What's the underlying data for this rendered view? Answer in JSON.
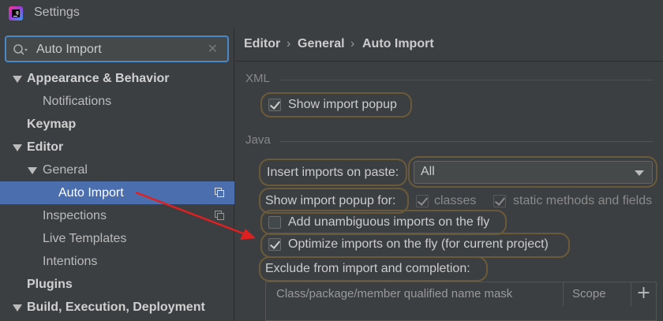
{
  "window": {
    "title": "Settings"
  },
  "search": {
    "value": "Auto Import",
    "clear_icon": "✕"
  },
  "tree": {
    "items": [
      {
        "label": "Appearance & Behavior"
      },
      {
        "label": "Notifications"
      },
      {
        "label": "Keymap"
      },
      {
        "label": "Editor"
      },
      {
        "label": "General"
      },
      {
        "label": "Auto Import"
      },
      {
        "label": "Inspections"
      },
      {
        "label": "Live Templates"
      },
      {
        "label": "Intentions"
      },
      {
        "label": "Plugins"
      },
      {
        "label": "Build, Execution, Deployment"
      }
    ]
  },
  "breadcrumb": {
    "items": [
      "Editor",
      "General",
      "Auto Import"
    ],
    "separator": "›"
  },
  "xml": {
    "section_title": "XML",
    "show_import_popup": {
      "label": "Show import popup",
      "checked": true
    }
  },
  "java": {
    "section_title": "Java",
    "insert_imports_on_paste": {
      "label": "Insert imports on paste:",
      "value": "All"
    },
    "show_import_popup_for": {
      "label": "Show import popup for:",
      "classes": {
        "label": "classes",
        "checked": true
      },
      "static_methods": {
        "label": "static methods and fields",
        "checked": true
      }
    },
    "add_unambiguous": {
      "label": "Add unambiguous imports on the fly",
      "checked": false
    },
    "optimize_imports": {
      "label": "Optimize imports on the fly (for current project)",
      "checked": true
    },
    "exclude_label": "Exclude from import and completion:",
    "exclude_table": {
      "columns": [
        "Class/package/member qualified name mask",
        "Scope"
      ],
      "add_label": "+"
    }
  },
  "colors": {
    "accent": "#4b6eaf",
    "annotation": "#e02020",
    "highlight": "#6b5a3a"
  }
}
